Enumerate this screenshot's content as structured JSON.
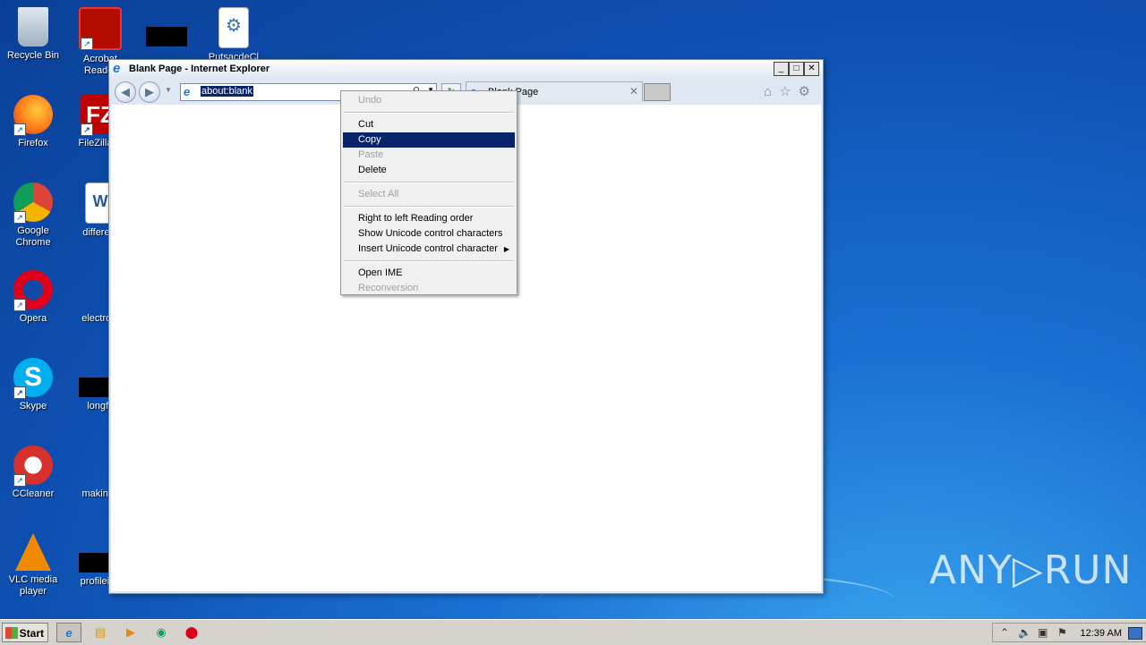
{
  "desktop": {
    "icons": [
      {
        "label": "Recycle Bin",
        "icon": "recycle-bin-icon"
      },
      {
        "label": "Acrobat Reader",
        "icon": "acrobat-reader-icon"
      },
      {
        "label": "Firefox",
        "icon": "firefox-icon"
      },
      {
        "label": "FileZilla C",
        "icon": "filezilla-icon"
      },
      {
        "label": "Google Chrome",
        "icon": "chrome-icon"
      },
      {
        "label": "different",
        "icon": "word-document-icon"
      },
      {
        "label": "Opera",
        "icon": "opera-icon"
      },
      {
        "label": "electroni",
        "icon": "file-icon"
      },
      {
        "label": "Skype",
        "icon": "skype-icon"
      },
      {
        "label": "longfl.",
        "icon": "file-icon"
      },
      {
        "label": "CCleaner",
        "icon": "ccleaner-icon"
      },
      {
        "label": "makingc",
        "icon": "file-icon"
      },
      {
        "label": "VLC media player",
        "icon": "vlc-icon"
      },
      {
        "label": "profileing",
        "icon": "file-icon"
      },
      {
        "label": "PutsacdeCl",
        "icon": "settings-file-icon"
      }
    ]
  },
  "window": {
    "title": "Blank Page - Internet Explorer",
    "minimize": "_",
    "maximize": "□",
    "close": "✕",
    "address": "about:blank",
    "tab_label": "Blank Page",
    "tab_close": "✕"
  },
  "context_menu": {
    "items": [
      {
        "label": "Undo",
        "enabled": false
      },
      {
        "label": "Cut",
        "enabled": true
      },
      {
        "label": "Copy",
        "enabled": true,
        "highlighted": true
      },
      {
        "label": "Paste",
        "enabled": false
      },
      {
        "label": "Delete",
        "enabled": true
      },
      {
        "label": "Select All",
        "enabled": false
      },
      {
        "label": "Right to left Reading order",
        "enabled": true
      },
      {
        "label": "Show Unicode control characters",
        "enabled": true
      },
      {
        "label": "Insert Unicode control character",
        "enabled": true,
        "submenu": true
      },
      {
        "label": "Open IME",
        "enabled": true
      },
      {
        "label": "Reconversion",
        "enabled": false
      }
    ]
  },
  "taskbar": {
    "start_label": "Start",
    "clock": "12:39 AM"
  },
  "watermark": "ANY▷RUN",
  "colors": {
    "selection": "#0a246a",
    "desktop": "#1a6fd0"
  }
}
